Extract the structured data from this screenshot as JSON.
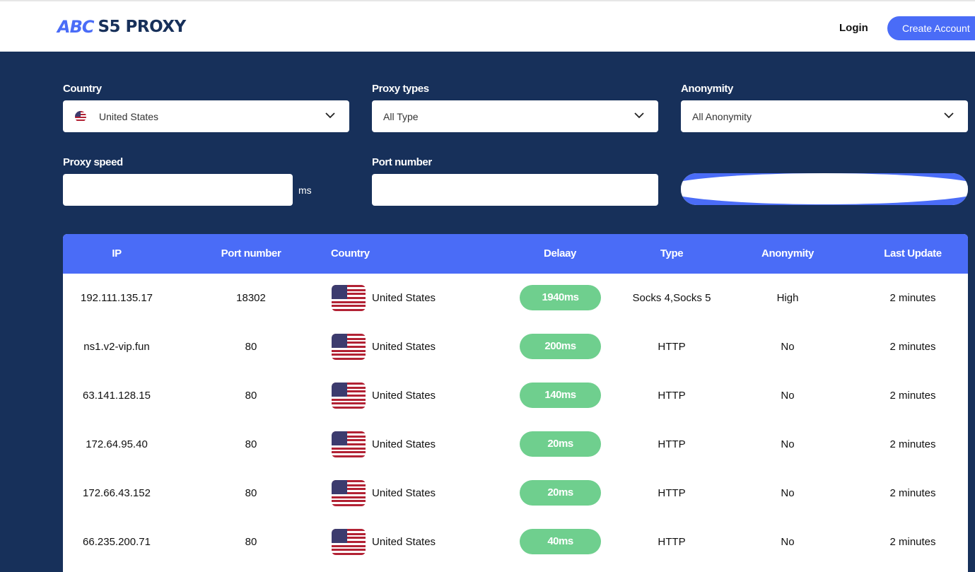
{
  "header": {
    "logo_mark": "ABC",
    "logo_text": "S5 PROXY",
    "login_label": "Login",
    "create_account_label": "Create Account"
  },
  "filters": {
    "country": {
      "label": "Country",
      "value": "United States",
      "icon": "us-flag-icon"
    },
    "proxy_types": {
      "label": "Proxy types",
      "value": "All Type"
    },
    "anonymity": {
      "label": "Anonymity",
      "value": "All Anonymity"
    },
    "proxy_speed": {
      "label": "Proxy speed",
      "value": "",
      "unit": "ms"
    },
    "port_number": {
      "label": "Port number",
      "value": ""
    },
    "search_button_label": ""
  },
  "table": {
    "headers": [
      "IP",
      "Port number",
      "Country",
      "Delaay",
      "Type",
      "Anonymity",
      "Last Update"
    ],
    "rows": [
      {
        "ip": "192.111.135.17",
        "port": "18302",
        "country": "United States",
        "delay": "1940ms",
        "type": "Socks 4,Socks 5",
        "anonymity": "High",
        "last_update": "2 minutes"
      },
      {
        "ip": "ns1.v2-vip.fun",
        "port": "80",
        "country": "United States",
        "delay": "200ms",
        "type": "HTTP",
        "anonymity": "No",
        "last_update": "2 minutes"
      },
      {
        "ip": "63.141.128.15",
        "port": "80",
        "country": "United States",
        "delay": "140ms",
        "type": "HTTP",
        "anonymity": "No",
        "last_update": "2 minutes"
      },
      {
        "ip": "172.64.95.40",
        "port": "80",
        "country": "United States",
        "delay": "20ms",
        "type": "HTTP",
        "anonymity": "No",
        "last_update": "2 minutes"
      },
      {
        "ip": "172.66.43.152",
        "port": "80",
        "country": "United States",
        "delay": "20ms",
        "type": "HTTP",
        "anonymity": "No",
        "last_update": "2 minutes"
      },
      {
        "ip": "66.235.200.71",
        "port": "80",
        "country": "United States",
        "delay": "40ms",
        "type": "HTTP",
        "anonymity": "No",
        "last_update": "2 minutes"
      }
    ]
  },
  "colors": {
    "primary": "#4a6cf7",
    "navy": "#17305a",
    "delay_pill": "#6fcf8e"
  }
}
